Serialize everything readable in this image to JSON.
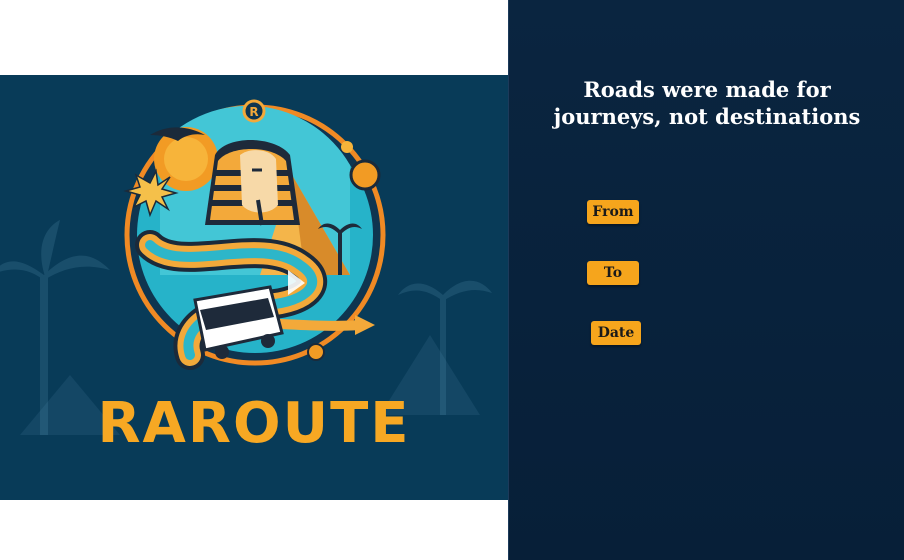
{
  "brand": {
    "name": "RAROUTE",
    "colors": {
      "panel": "#083b58",
      "accent": "#f7a823",
      "sidebar": "#0a2540"
    }
  },
  "tagline": {
    "line1": "Roads were made for",
    "line2": "journeys, not destinations"
  },
  "form": {
    "from_label": "From",
    "to_label": "To",
    "date_label": "Date"
  },
  "logo": {
    "emblem_letter": "R",
    "icons": [
      "pharaoh-icon",
      "pyramid-icon",
      "bus-icon",
      "road-icon",
      "palm-tree-icon",
      "sun-icon",
      "bird-icon",
      "star-icon"
    ]
  }
}
